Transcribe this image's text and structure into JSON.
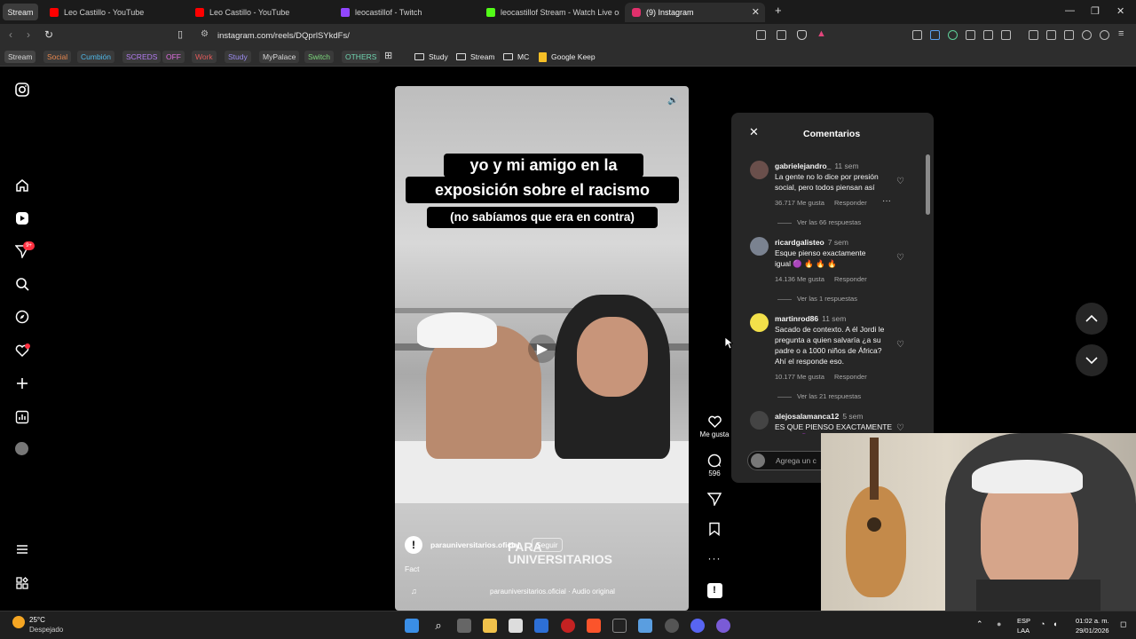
{
  "browser": {
    "workspace_label": "Stream",
    "tabs": [
      {
        "title": "Leo Castillo - YouTube",
        "color": "#ff0000"
      },
      {
        "title": "Leo Castillo - YouTube",
        "color": "#ff0000"
      },
      {
        "title": "leocastillof - Twitch",
        "color": "#9146ff"
      },
      {
        "title": "leocastillof Stream - Watch Live on K",
        "color": "#53fc18"
      },
      {
        "title": "(9) Instagram",
        "color": "#e1306c"
      }
    ],
    "new_tab": "+",
    "url": "instagram.com/reels/DQprlSYkdFs/",
    "bookmarks_tags": [
      {
        "label": "Stream",
        "color": "#d9d9d9"
      },
      {
        "label": "Social",
        "color": "#e8884f"
      },
      {
        "label": "Cumbión",
        "color": "#4fb8e8"
      },
      {
        "label": "SCREDS",
        "color": "#b37cf0"
      },
      {
        "label": "OFF",
        "color": "#e06fe0"
      },
      {
        "label": "Work",
        "color": "#e05a5a"
      },
      {
        "label": "Study",
        "color": "#9c8cf0"
      },
      {
        "label": "MyPalace",
        "color": "#d9d9d9"
      },
      {
        "label": "Switch",
        "color": "#7bd87b"
      },
      {
        "label": "OTHERS",
        "color": "#6fd4b0"
      }
    ],
    "bookmark_folders": [
      "Study",
      "Stream",
      "MC"
    ],
    "google_keep": "Google Keep"
  },
  "instagram": {
    "nav_badge": "9+",
    "reel": {
      "caption_line1": "yo y mi amigo en la",
      "caption_line2": "exposición sobre el racismo",
      "caption_line3": "(no sabíamos que era en contra)",
      "account": "parauniversitarios.oficial",
      "follow": "Seguir",
      "watermark_line1": "PARA",
      "watermark_line2": "UNIVERSITARIOS",
      "description": "Fact",
      "audio": "parauniversitarios.oficial · Audio original"
    },
    "actions": {
      "likes_label": "Me gusta",
      "comments_count": "596"
    },
    "comments_panel": {
      "title": "Comentarios",
      "add_placeholder": "Agrega un c",
      "items": [
        {
          "user": "gabrielejandro_",
          "time": "11 sem",
          "text": "La gente no lo dice por presión social, pero todos piensan así",
          "likes": "36.717 Me gusta",
          "reply": "Responder",
          "more": "···",
          "replies": "Ver las 66 respuestas",
          "avatar_color": "#6a4f4b"
        },
        {
          "user": "ricardgalisteo",
          "time": "7 sem",
          "text": "Esque pienso exactamente igual 🟣 🔥 🔥 🔥",
          "likes": "14.136 Me gusta",
          "reply": "Responder",
          "replies": "Ver las 1 respuestas",
          "avatar_color": "#7a8290"
        },
        {
          "user": "martinrod86",
          "time": "11 sem",
          "text": "Sacado de contexto. A él Jordi le pregunta a quien salvaría ¿a su padre o a 1000 niños de África? Ahí el responde eso.",
          "likes": "10.177 Me gusta",
          "reply": "Responder",
          "replies": "Ver las 21 respuestas",
          "avatar_color": "#f2e04a"
        },
        {
          "user": "alejosalamanca12",
          "time": "5 sem",
          "text": "ES QUE PIENSO EXACTAMENTE IGUAL 🟣",
          "avatar_color": "#444"
        }
      ]
    }
  },
  "taskbar": {
    "temperature": "25°C",
    "weather": "Despejado",
    "language_top": "ESP",
    "language_bottom": "LAA",
    "time": "01:02 a. m.",
    "date": "29/01/2026"
  }
}
